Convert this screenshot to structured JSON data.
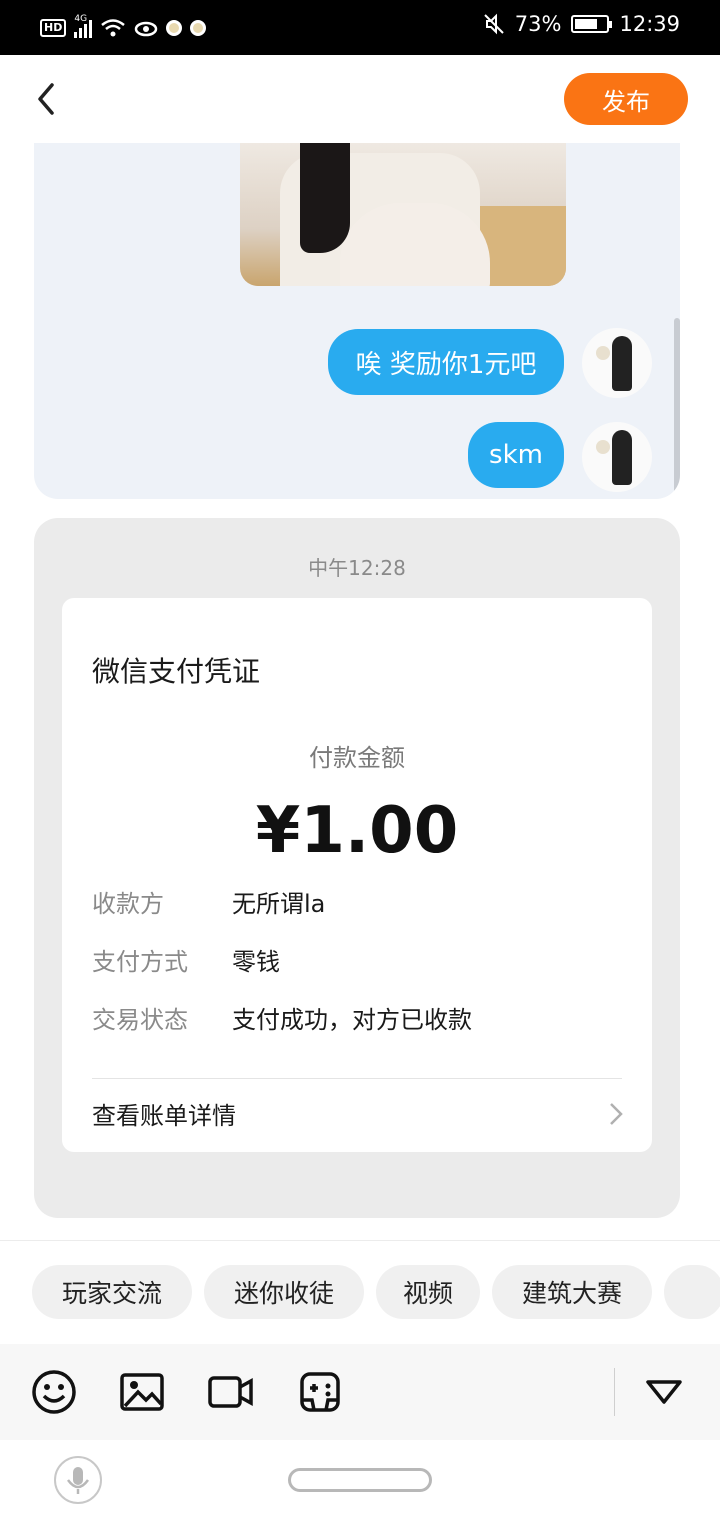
{
  "status_bar": {
    "network_label": "4G",
    "hd_label": "HD",
    "battery": "73%",
    "battery_level": 0.73,
    "time": "12:39"
  },
  "header": {
    "back_icon": "back-arrow-icon",
    "publish_label": "发布"
  },
  "chat": {
    "messages": [
      {
        "text": "唉 奖励你1元吧",
        "side": "right"
      },
      {
        "text": "skm",
        "side": "right"
      }
    ]
  },
  "payment": {
    "timestamp": "中午12:28",
    "title": "微信支付凭证",
    "amount_label": "付款金额",
    "amount": "¥1.00",
    "rows": [
      {
        "key": "收款方",
        "value": "无所谓la"
      },
      {
        "key": "支付方式",
        "value": "零钱"
      },
      {
        "key": "交易状态",
        "value": "支付成功，对方已收款"
      }
    ],
    "details_link": "查看账单详情"
  },
  "topics": [
    "玩家交流",
    "迷你收徒",
    "视频",
    "建筑大赛"
  ],
  "toolbar": {
    "icons": [
      "emoji-icon",
      "image-icon",
      "video-icon",
      "gamepad-icon",
      "collapse-triangle-icon"
    ]
  },
  "colors": {
    "accent": "#fa7414",
    "bubble": "#29abef"
  }
}
